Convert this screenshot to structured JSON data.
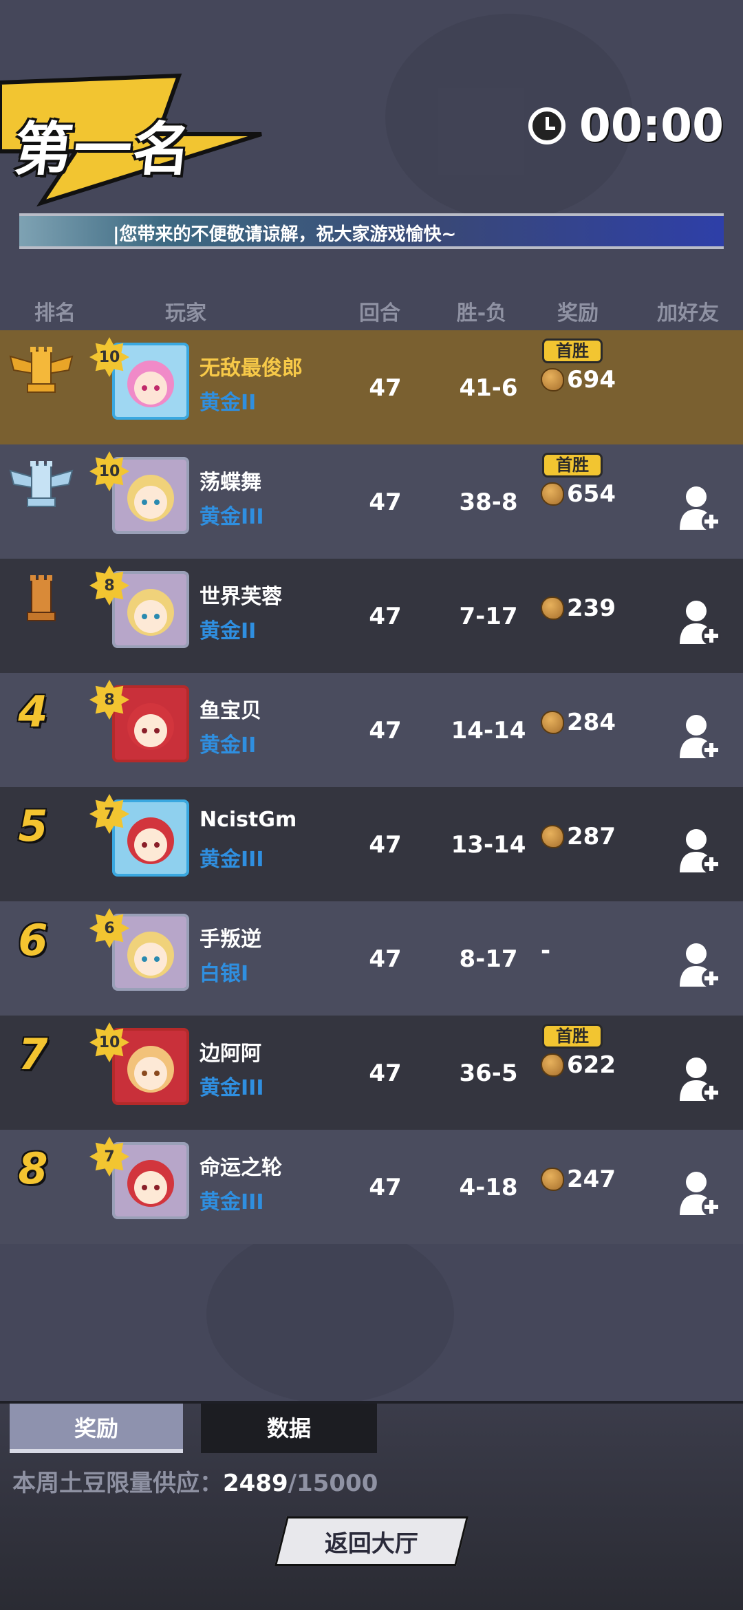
{
  "header": {
    "rank_title": "第一名",
    "timer": "00:00",
    "ticker": "|您带来的不便敬请谅解，祝大家游戏愉快~"
  },
  "columns": [
    "排名",
    "玩家",
    "回合",
    "胜-负",
    "奖励",
    "加好友"
  ],
  "players": [
    {
      "rank": "1",
      "trophy": "gold-winged-rook-icon",
      "level": "10",
      "name": "无敌最俊郎",
      "tier": "黄金II",
      "rounds": "47",
      "wl": "41-6",
      "badge": "首胜",
      "reward": "694",
      "add_friend": false
    },
    {
      "rank": "2",
      "trophy": "silver-winged-rook-icon",
      "level": "10",
      "name": "荡蝶舞",
      "tier": "黄金III",
      "rounds": "47",
      "wl": "38-8",
      "badge": "首胜",
      "reward": "654",
      "add_friend": true
    },
    {
      "rank": "3",
      "trophy": "bronze-rook-icon",
      "level": "8",
      "name": "世界芙蓉",
      "tier": "黄金II",
      "rounds": "47",
      "wl": "7-17",
      "badge": "",
      "reward": "239",
      "add_friend": true
    },
    {
      "rank": "4",
      "level": "8",
      "name": "鱼宝贝",
      "tier": "黄金II",
      "rounds": "47",
      "wl": "14-14",
      "badge": "",
      "reward": "284",
      "add_friend": true
    },
    {
      "rank": "5",
      "level": "7",
      "name": "NcistGm",
      "tier": "黄金III",
      "rounds": "47",
      "wl": "13-14",
      "badge": "",
      "reward": "287",
      "add_friend": true
    },
    {
      "rank": "6",
      "level": "6",
      "name": "手叛逆",
      "tier": "白银I",
      "rounds": "47",
      "wl": "8-17",
      "badge": "",
      "reward": "-",
      "add_friend": true
    },
    {
      "rank": "7",
      "level": "10",
      "name": "边阿阿",
      "tier": "黄金III",
      "rounds": "47",
      "wl": "36-5",
      "badge": "首胜",
      "reward": "622",
      "add_friend": true
    },
    {
      "rank": "8",
      "level": "7",
      "name": "命运之轮",
      "tier": "黄金III",
      "rounds": "47",
      "wl": "4-18",
      "badge": "",
      "reward": "247",
      "add_friend": true
    }
  ],
  "tabs": {
    "reward": "奖励",
    "data": "数据"
  },
  "supply": {
    "label": "本周土豆限量供应：",
    "current": "2489",
    "total": "/15000"
  },
  "back_button": "返回大厅",
  "colors": {
    "accent_yellow": "#f2c531",
    "tier_blue": "#2f8fe0",
    "first_row": "#7a6030"
  }
}
